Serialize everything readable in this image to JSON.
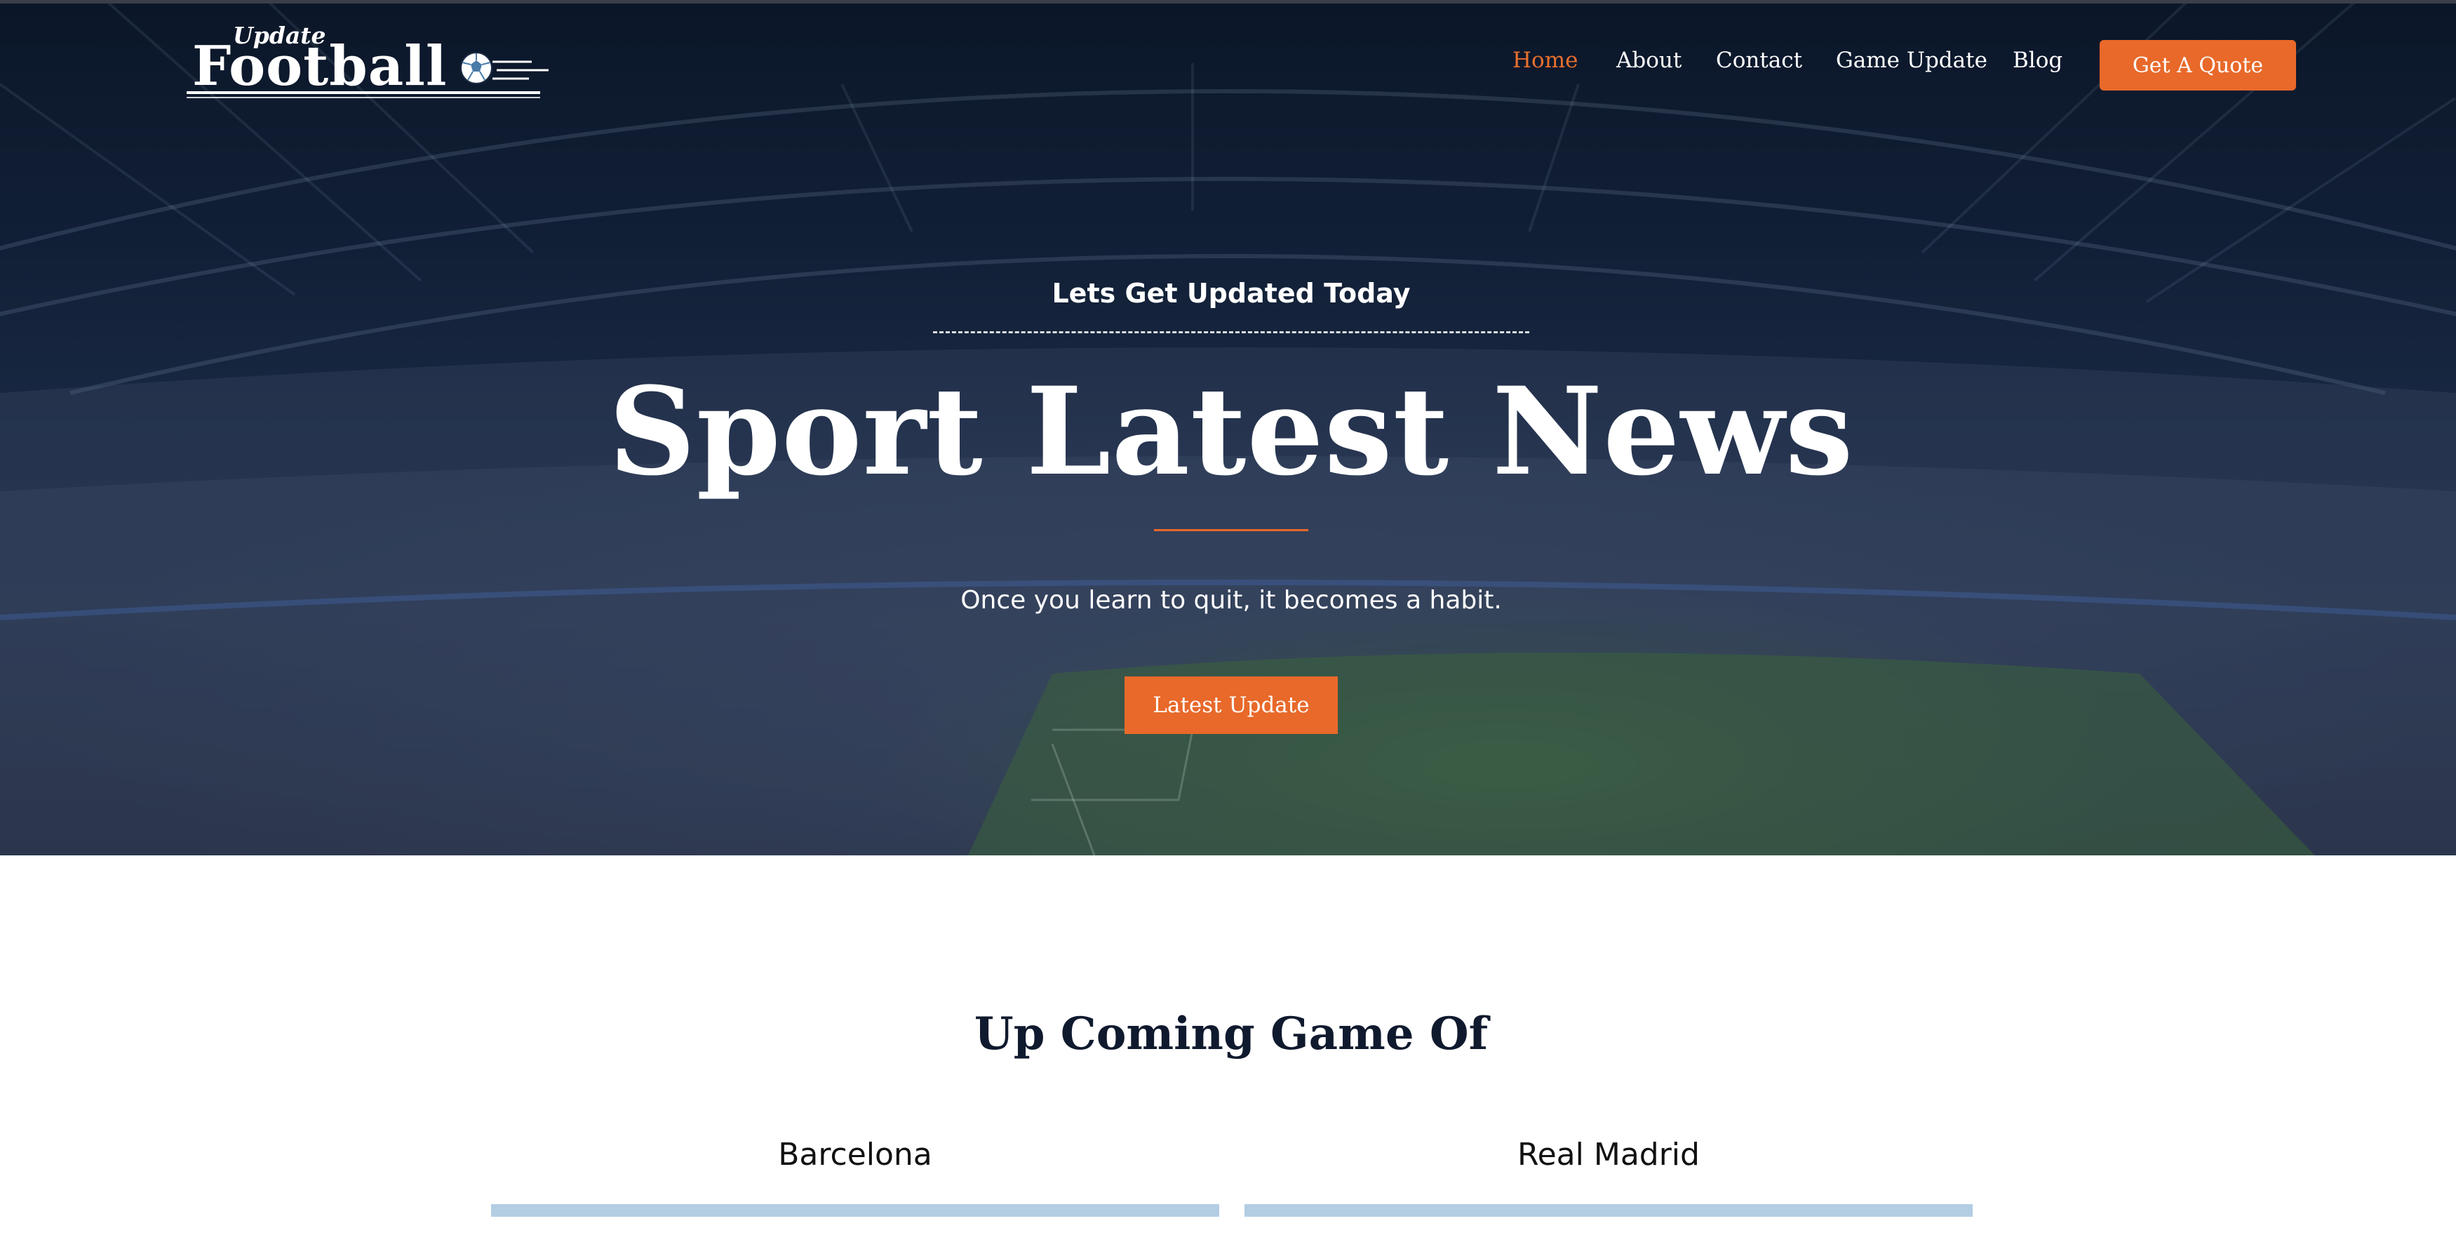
{
  "logo": {
    "small_text": "Update",
    "main_text": "Football"
  },
  "nav": {
    "items": [
      {
        "label": "Home",
        "active": true
      },
      {
        "label": "About",
        "active": false
      },
      {
        "label": "Contact",
        "active": false
      },
      {
        "label": "Game Update",
        "active": false
      },
      {
        "label": "Blog",
        "active": false
      }
    ],
    "cta_label": "Get A Quote"
  },
  "hero": {
    "kicker": "Lets Get Updated Today",
    "title": "Sport Latest News",
    "subtitle": "Once you learn to quit, it becomes a habit.",
    "cta_label": "Latest Update"
  },
  "upcoming": {
    "title": "Up Coming Game Of",
    "teams": [
      {
        "name": "Barcelona"
      },
      {
        "name": "Real Madrid"
      }
    ]
  },
  "colors": {
    "accent": "#e8692a",
    "hero_overlay": "#111f36",
    "heading_dark": "#101a2e",
    "team_bar": "#b3cde3"
  },
  "icons": {
    "logo_ball": "soccer-ball-icon"
  }
}
